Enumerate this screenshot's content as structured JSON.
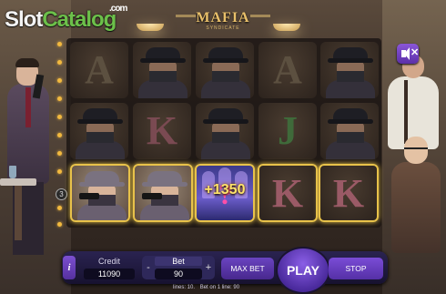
{
  "site_logo": {
    "slot": "Slot",
    "catalog": "Catalog",
    "com": ".com"
  },
  "game_logo": {
    "title": "MAFIA",
    "subtitle": "SYNDICATE"
  },
  "reels": [
    [
      "A",
      "gangster-with-hat",
      "gangster-with-hat",
      "A",
      "gangster-with-hat"
    ],
    [
      "gangster-with-hat",
      "K",
      "gangster-with-hat",
      "J",
      "gangster-with-hat"
    ],
    [
      "gangster-with-gun",
      "gangster-with-gun",
      "bonus",
      "K",
      "K"
    ]
  ],
  "bonus_amount": "+1350",
  "line_marker": "3",
  "controls": {
    "info": "i",
    "credit_label": "Credit",
    "credit_value": "11090",
    "bet_label": "Bet",
    "bet_value": "90",
    "minus": "-",
    "plus": "+",
    "max_bet": "MAX BET",
    "play": "PLAY",
    "stop": "STOP"
  },
  "footer": {
    "lines": "lines: 10.",
    "bet_on_line": "Bet on 1 line: 90"
  },
  "colors": {
    "win_border": "#e8c24a",
    "button_purple": "#6a44c0",
    "bar_bg": "#1c1638"
  }
}
